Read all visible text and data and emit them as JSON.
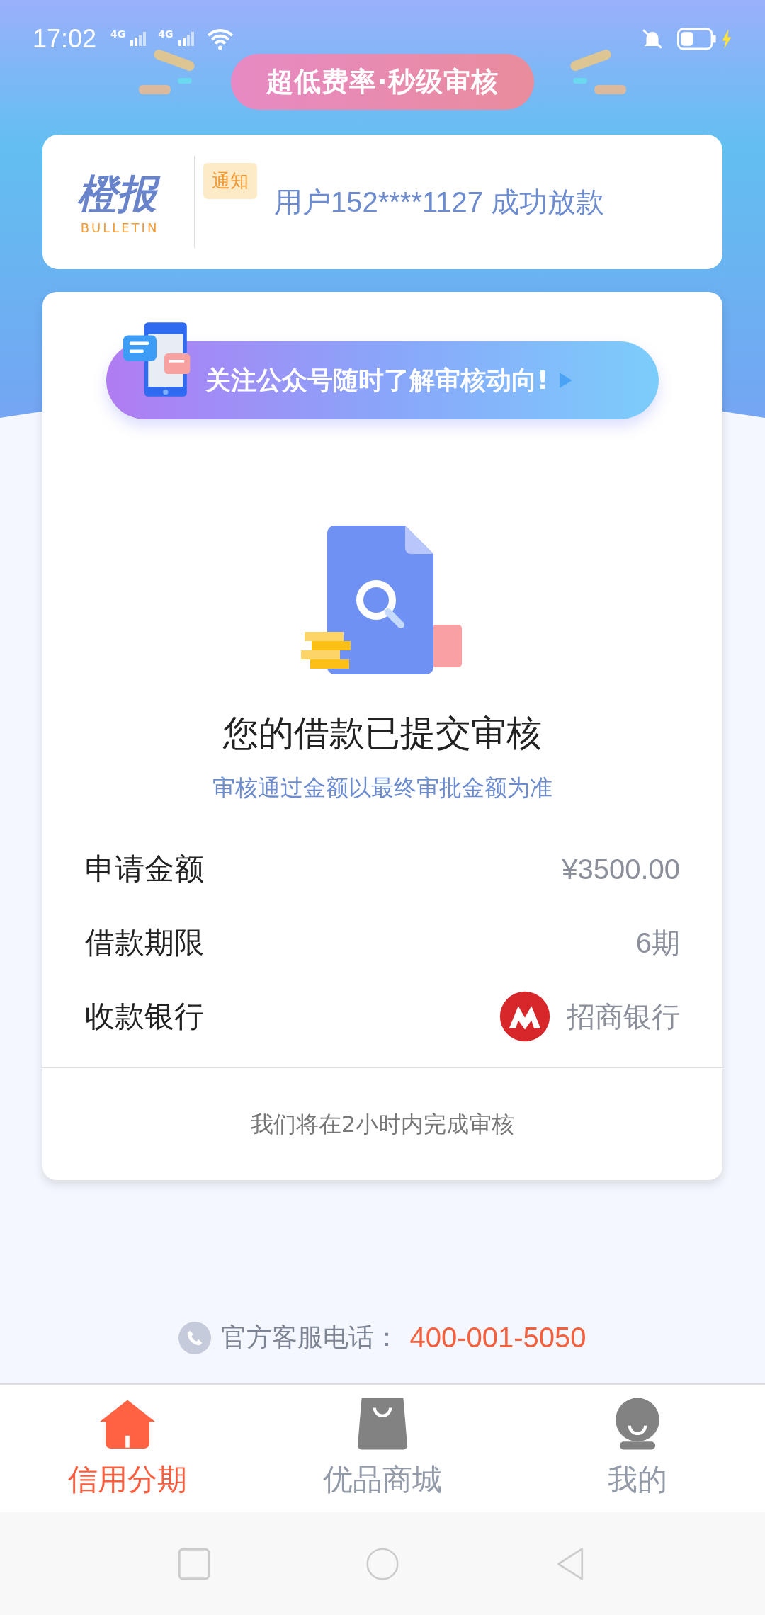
{
  "status_bar": {
    "time": "17:02",
    "network_1": "4G",
    "network_2": "4G"
  },
  "promo": {
    "slogan": "超低费率·秒级审核"
  },
  "bulletin": {
    "logo_title": "橙报",
    "logo_subtitle": "BULLETIN",
    "tag": "通知",
    "message": "用户152****1127 成功放款"
  },
  "follow_banner": {
    "text": "关注公众号随时了解审核动向!"
  },
  "status": {
    "title": "您的借款已提交审核",
    "subtitle": "审核通过金额以最终审批金额为准"
  },
  "details": [
    {
      "kind": "text",
      "label": "申请金额",
      "value": "¥3500.00"
    },
    {
      "kind": "text",
      "label": "借款期限",
      "value": "6期"
    },
    {
      "kind": "bank",
      "label": "收款银行",
      "value": "招商银行"
    }
  ],
  "footer_note": "我们将在2小时内完成审核",
  "hotline": {
    "label": "官方客服电话：",
    "number": "400-001-5050"
  },
  "tabs": [
    {
      "kind": "home",
      "label": "信用分期",
      "selected": true
    },
    {
      "kind": "bag",
      "label": "优品商城",
      "selected": false
    },
    {
      "kind": "profile",
      "label": "我的",
      "selected": false
    }
  ]
}
